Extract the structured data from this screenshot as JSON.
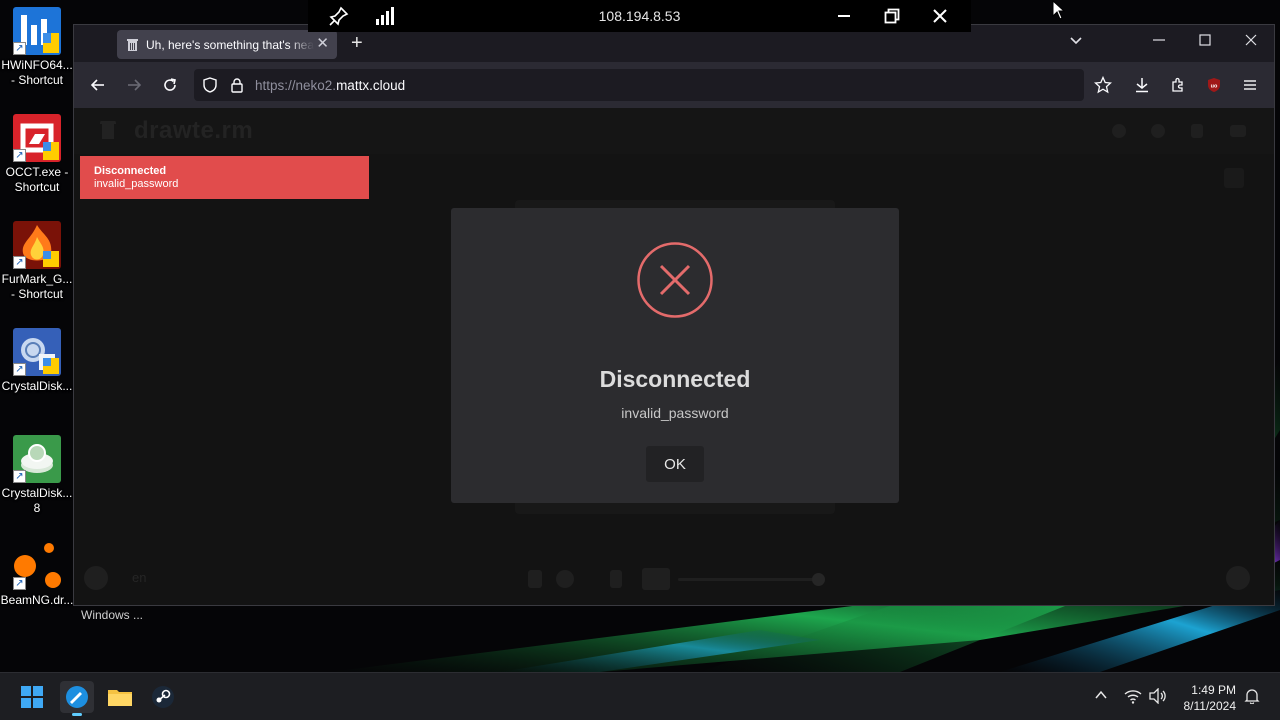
{
  "remote_toolbar": {
    "title": "108.194.8.53"
  },
  "desktop_icons": [
    {
      "name": "desktop-icon-hwinfo",
      "label": "HWiNFO64...\n- Shortcut"
    },
    {
      "name": "desktop-icon-occt",
      "label": "OCCT.exe -\nShortcut"
    },
    {
      "name": "desktop-icon-furmark",
      "label": "FurMark_G...\n- Shortcut"
    },
    {
      "name": "desktop-icon-crystaldisk-1",
      "label": "CrystalDisk..."
    },
    {
      "name": "desktop-icon-crystaldisk-2",
      "label": "CrystalDisk...\n8"
    },
    {
      "name": "desktop-icon-beamng",
      "label": "BeamNG.dr..."
    }
  ],
  "browser": {
    "tab_title": "Uh, here's something that's neat",
    "url_scheme": "https://neko2.",
    "url_host": "mattx.cloud"
  },
  "page": {
    "logo": "drawte.rm",
    "footer_lang": "en"
  },
  "notification": {
    "title": "Disconnected",
    "text": "invalid_password",
    "color": "#e14c4c"
  },
  "modal": {
    "title": "Disconnected",
    "message": "invalid_password",
    "ok_label": "OK",
    "icon": "x-circle-icon",
    "accent": "#e46b6b"
  },
  "desktop": {
    "window_label": "Windows ..."
  },
  "taskbar": {
    "time": "1:49 PM",
    "date": "8/11/2024"
  }
}
